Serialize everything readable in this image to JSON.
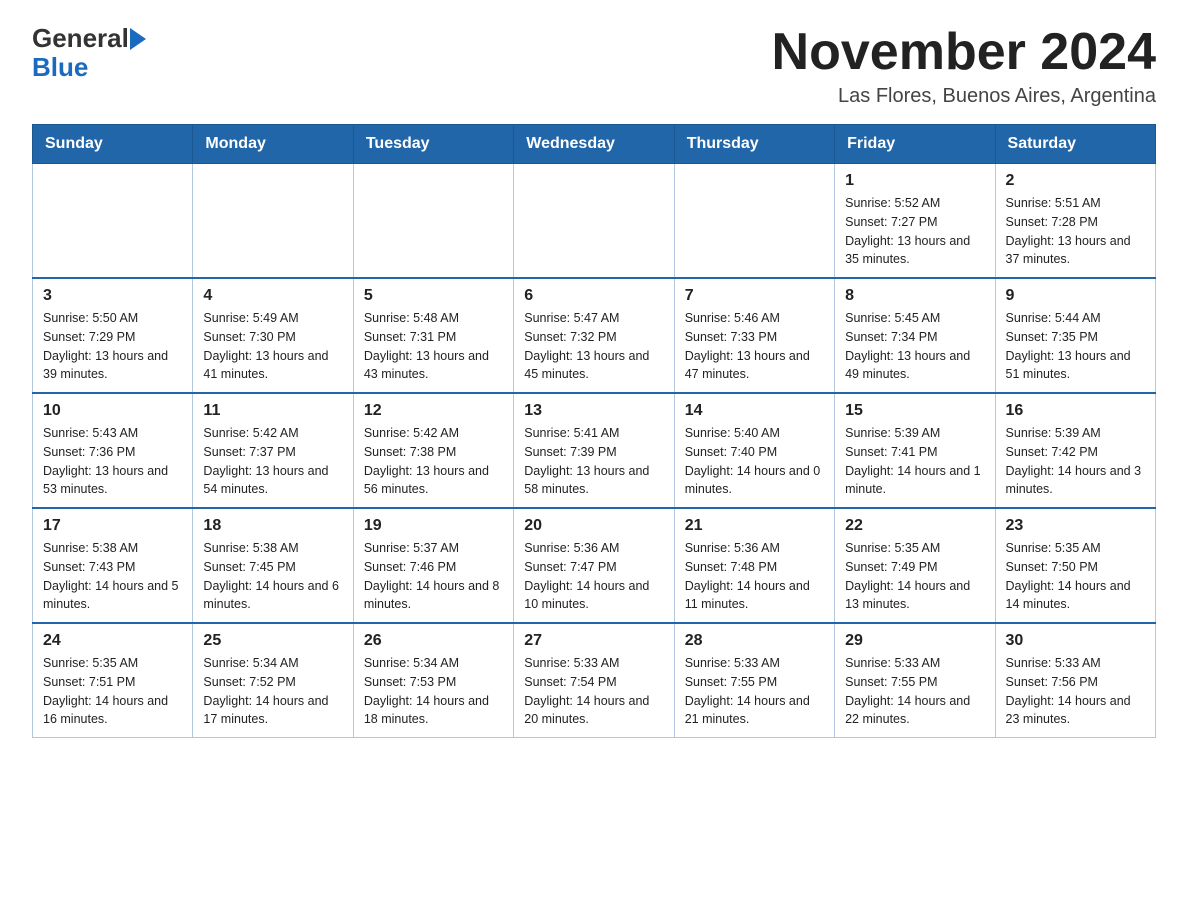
{
  "header": {
    "logo_line1": "General",
    "logo_line2": "Blue",
    "month_title": "November 2024",
    "location": "Las Flores, Buenos Aires, Argentina"
  },
  "calendar": {
    "days_of_week": [
      "Sunday",
      "Monday",
      "Tuesday",
      "Wednesday",
      "Thursday",
      "Friday",
      "Saturday"
    ],
    "rows": [
      [
        {
          "day": "",
          "info": ""
        },
        {
          "day": "",
          "info": ""
        },
        {
          "day": "",
          "info": ""
        },
        {
          "day": "",
          "info": ""
        },
        {
          "day": "",
          "info": ""
        },
        {
          "day": "1",
          "info": "Sunrise: 5:52 AM\nSunset: 7:27 PM\nDaylight: 13 hours and 35 minutes."
        },
        {
          "day": "2",
          "info": "Sunrise: 5:51 AM\nSunset: 7:28 PM\nDaylight: 13 hours and 37 minutes."
        }
      ],
      [
        {
          "day": "3",
          "info": "Sunrise: 5:50 AM\nSunset: 7:29 PM\nDaylight: 13 hours and 39 minutes."
        },
        {
          "day": "4",
          "info": "Sunrise: 5:49 AM\nSunset: 7:30 PM\nDaylight: 13 hours and 41 minutes."
        },
        {
          "day": "5",
          "info": "Sunrise: 5:48 AM\nSunset: 7:31 PM\nDaylight: 13 hours and 43 minutes."
        },
        {
          "day": "6",
          "info": "Sunrise: 5:47 AM\nSunset: 7:32 PM\nDaylight: 13 hours and 45 minutes."
        },
        {
          "day": "7",
          "info": "Sunrise: 5:46 AM\nSunset: 7:33 PM\nDaylight: 13 hours and 47 minutes."
        },
        {
          "day": "8",
          "info": "Sunrise: 5:45 AM\nSunset: 7:34 PM\nDaylight: 13 hours and 49 minutes."
        },
        {
          "day": "9",
          "info": "Sunrise: 5:44 AM\nSunset: 7:35 PM\nDaylight: 13 hours and 51 minutes."
        }
      ],
      [
        {
          "day": "10",
          "info": "Sunrise: 5:43 AM\nSunset: 7:36 PM\nDaylight: 13 hours and 53 minutes."
        },
        {
          "day": "11",
          "info": "Sunrise: 5:42 AM\nSunset: 7:37 PM\nDaylight: 13 hours and 54 minutes."
        },
        {
          "day": "12",
          "info": "Sunrise: 5:42 AM\nSunset: 7:38 PM\nDaylight: 13 hours and 56 minutes."
        },
        {
          "day": "13",
          "info": "Sunrise: 5:41 AM\nSunset: 7:39 PM\nDaylight: 13 hours and 58 minutes."
        },
        {
          "day": "14",
          "info": "Sunrise: 5:40 AM\nSunset: 7:40 PM\nDaylight: 14 hours and 0 minutes."
        },
        {
          "day": "15",
          "info": "Sunrise: 5:39 AM\nSunset: 7:41 PM\nDaylight: 14 hours and 1 minute."
        },
        {
          "day": "16",
          "info": "Sunrise: 5:39 AM\nSunset: 7:42 PM\nDaylight: 14 hours and 3 minutes."
        }
      ],
      [
        {
          "day": "17",
          "info": "Sunrise: 5:38 AM\nSunset: 7:43 PM\nDaylight: 14 hours and 5 minutes."
        },
        {
          "day": "18",
          "info": "Sunrise: 5:38 AM\nSunset: 7:45 PM\nDaylight: 14 hours and 6 minutes."
        },
        {
          "day": "19",
          "info": "Sunrise: 5:37 AM\nSunset: 7:46 PM\nDaylight: 14 hours and 8 minutes."
        },
        {
          "day": "20",
          "info": "Sunrise: 5:36 AM\nSunset: 7:47 PM\nDaylight: 14 hours and 10 minutes."
        },
        {
          "day": "21",
          "info": "Sunrise: 5:36 AM\nSunset: 7:48 PM\nDaylight: 14 hours and 11 minutes."
        },
        {
          "day": "22",
          "info": "Sunrise: 5:35 AM\nSunset: 7:49 PM\nDaylight: 14 hours and 13 minutes."
        },
        {
          "day": "23",
          "info": "Sunrise: 5:35 AM\nSunset: 7:50 PM\nDaylight: 14 hours and 14 minutes."
        }
      ],
      [
        {
          "day": "24",
          "info": "Sunrise: 5:35 AM\nSunset: 7:51 PM\nDaylight: 14 hours and 16 minutes."
        },
        {
          "day": "25",
          "info": "Sunrise: 5:34 AM\nSunset: 7:52 PM\nDaylight: 14 hours and 17 minutes."
        },
        {
          "day": "26",
          "info": "Sunrise: 5:34 AM\nSunset: 7:53 PM\nDaylight: 14 hours and 18 minutes."
        },
        {
          "day": "27",
          "info": "Sunrise: 5:33 AM\nSunset: 7:54 PM\nDaylight: 14 hours and 20 minutes."
        },
        {
          "day": "28",
          "info": "Sunrise: 5:33 AM\nSunset: 7:55 PM\nDaylight: 14 hours and 21 minutes."
        },
        {
          "day": "29",
          "info": "Sunrise: 5:33 AM\nSunset: 7:55 PM\nDaylight: 14 hours and 22 minutes."
        },
        {
          "day": "30",
          "info": "Sunrise: 5:33 AM\nSunset: 7:56 PM\nDaylight: 14 hours and 23 minutes."
        }
      ]
    ]
  }
}
